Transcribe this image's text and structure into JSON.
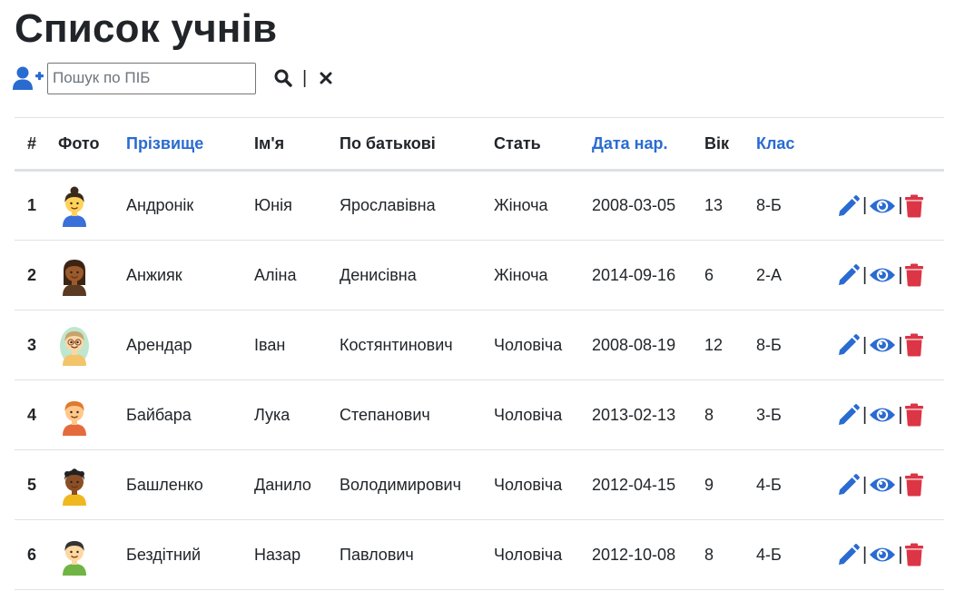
{
  "page": {
    "title": "Список учнів"
  },
  "toolbar": {
    "search_placeholder": "Пошук по ПІБ",
    "search_value": "",
    "separator": "|",
    "add_user_icon": "user-plus-icon",
    "search_icon": "magnifier-icon",
    "clear_icon": "close-icon"
  },
  "colors": {
    "accent": "#2a6bd1",
    "danger": "#dc3545",
    "text": "#212529",
    "border": "#dee2e6"
  },
  "table": {
    "headers": [
      "#",
      "Фото",
      "Прізвище",
      "Ім'я",
      "По батькові",
      "Стать",
      "Дата нар.",
      "Вік",
      "Клас"
    ],
    "sortable": [
      "Прізвище",
      "Дата нар.",
      "Клас"
    ],
    "rows": [
      {
        "num": "1",
        "photo": "girl-with-bun-avatar",
        "surname": "Андронік",
        "name": "Юнія",
        "patronymic": "Ярославівна",
        "gender": "Жіноча",
        "birth": "2008-03-05",
        "age": "13",
        "class": "8-Б"
      },
      {
        "num": "2",
        "photo": "dark-skinned-girl-avatar",
        "surname": "Анжияк",
        "name": "Аліна",
        "patronymic": "Денисівна",
        "gender": "Жіноча",
        "birth": "2014-09-16",
        "age": "6",
        "class": "2-А"
      },
      {
        "num": "3",
        "photo": "boy-with-glasses-avatar",
        "surname": "Арендар",
        "name": "Іван",
        "patronymic": "Костянтинович",
        "gender": "Чоловіча",
        "birth": "2008-08-19",
        "age": "12",
        "class": "8-Б"
      },
      {
        "num": "4",
        "photo": "red-haired-boy-avatar",
        "surname": "Байбара",
        "name": "Лука",
        "patronymic": "Степанович",
        "gender": "Чоловіча",
        "birth": "2013-02-13",
        "age": "8",
        "class": "3-Б"
      },
      {
        "num": "5",
        "photo": "dark-skinned-boy-avatar",
        "surname": "Башленко",
        "name": "Данило",
        "patronymic": "Володимирович",
        "gender": "Чоловіча",
        "birth": "2012-04-15",
        "age": "9",
        "class": "4-Б"
      },
      {
        "num": "6",
        "photo": "boy-green-shirt-avatar",
        "surname": "Бездітний",
        "name": "Назар",
        "patronymic": "Павлович",
        "gender": "Чоловіча",
        "birth": "2012-10-08",
        "age": "8",
        "class": "4-Б"
      }
    ],
    "row_actions": {
      "edit_icon": "pencil-icon",
      "view_icon": "eye-icon",
      "delete_icon": "trash-icon",
      "separator": "|"
    }
  }
}
